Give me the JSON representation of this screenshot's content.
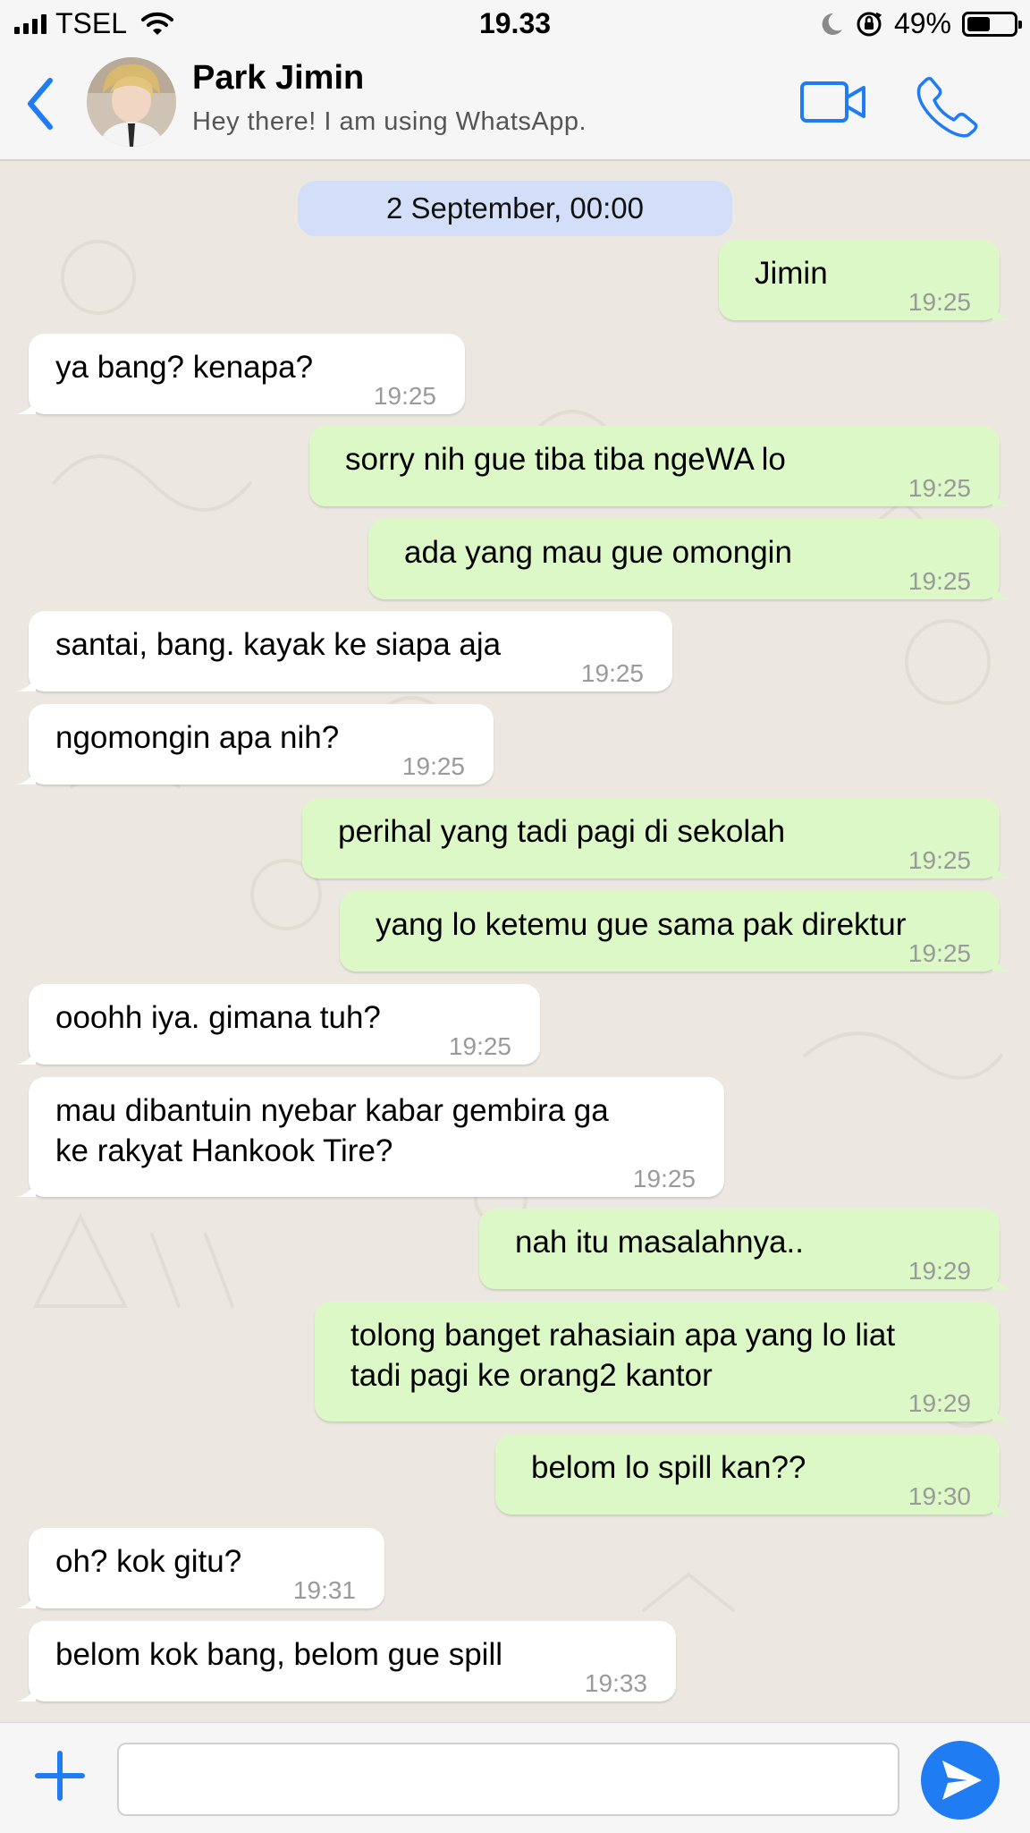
{
  "status_bar": {
    "carrier": "TSEL",
    "time": "19.33",
    "battery_percent_text": "49%",
    "battery_level": 0.49
  },
  "header": {
    "contact_name": "Park Jimin",
    "contact_status": "Hey there! I am using WhatsApp."
  },
  "chat": {
    "date_label": "2 September, 00:00",
    "messages": [
      {
        "dir": "out",
        "text": "Jimin",
        "time": "19:25"
      },
      {
        "dir": "in",
        "text": "ya bang? kenapa?",
        "time": "19:25"
      },
      {
        "dir": "out",
        "text": "sorry nih gue tiba tiba ngeWA lo",
        "time": "19:25"
      },
      {
        "dir": "out",
        "text": "ada yang mau gue omongin",
        "time": "19:25"
      },
      {
        "dir": "in",
        "text": "santai, bang. kayak ke siapa aja",
        "time": "19:25"
      },
      {
        "dir": "in",
        "text": "ngomongin apa nih?",
        "time": "19:25"
      },
      {
        "dir": "out",
        "text": "perihal yang tadi pagi di sekolah",
        "time": "19:25"
      },
      {
        "dir": "out",
        "text": "yang lo ketemu gue sama pak direktur",
        "time": "19:25"
      },
      {
        "dir": "in",
        "text": "ooohh iya. gimana tuh?",
        "time": "19:25"
      },
      {
        "dir": "in",
        "text": "mau dibantuin nyebar kabar gembira ga\nke rakyat Hankook Tire?",
        "time": "19:25"
      },
      {
        "dir": "out",
        "text": "nah itu masalahnya..",
        "time": "19:29"
      },
      {
        "dir": "out",
        "text": "tolong banget rahasiain apa yang lo liat\ntadi pagi ke orang2 kantor",
        "time": "19:29"
      },
      {
        "dir": "out",
        "text": "belom lo spill kan??",
        "time": "19:30"
      },
      {
        "dir": "in",
        "text": "oh? kok gitu?",
        "time": "19:31"
      },
      {
        "dir": "in",
        "text": "belom kok bang, belom gue spill",
        "time": "19:33"
      }
    ]
  },
  "input": {
    "value": "",
    "placeholder": ""
  },
  "colors": {
    "accent": "#1f7cf3",
    "outgoing_bubble": "#dcf8c6",
    "incoming_bubble": "#ffffff",
    "date_pill": "#d3dff8",
    "chat_background": "#ece8e1"
  },
  "icons": [
    "cellular-signal-icon",
    "wifi-icon",
    "moon-icon",
    "orientation-lock-icon",
    "battery-icon",
    "back-chevron-icon",
    "video-call-icon",
    "phone-call-icon",
    "plus-icon",
    "send-icon"
  ]
}
